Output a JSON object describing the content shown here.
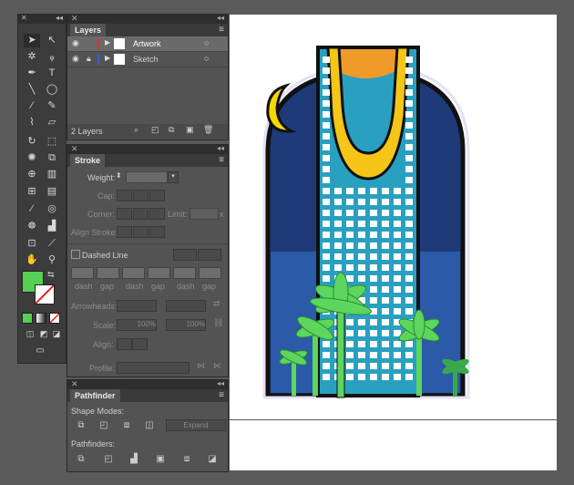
{
  "layers": {
    "title": "Layers",
    "items": [
      {
        "name": "Artwork",
        "color": "#c83c3c"
      },
      {
        "name": "Sketch",
        "color": "#3c5ac8"
      }
    ],
    "count": "2 Layers"
  },
  "stroke": {
    "title": "Stroke",
    "weight_label": "Weight:",
    "cap_label": "Cap:",
    "corner_label": "Corner:",
    "limit_label": "Limit:",
    "limit_unit": "x",
    "align_label": "Align Stroke:",
    "dashed_label": "Dashed Line",
    "dash_fields": [
      "dash",
      "gap",
      "dash",
      "gap",
      "dash",
      "gap"
    ],
    "arrowheads_label": "Arrowheads:",
    "scale_label": "Scale:",
    "scale_values": [
      "100%",
      "100%"
    ],
    "align_label2": "Align:",
    "profile_label": "Profile:"
  },
  "pathfinder": {
    "title": "Pathfinder",
    "shape_modes_label": "Shape Modes:",
    "expand_label": "Expand",
    "pathfinders_label": "Pathfinders:"
  },
  "colors": {
    "fill": "#55d055",
    "sky": "#1e3a78",
    "sky_light": "#2a5aa8",
    "building": "#2aa0c0",
    "gold": "#f5c518",
    "orange": "#f09a2a",
    "palm": "#5cd65c",
    "palm_dark": "#3aa84a"
  }
}
